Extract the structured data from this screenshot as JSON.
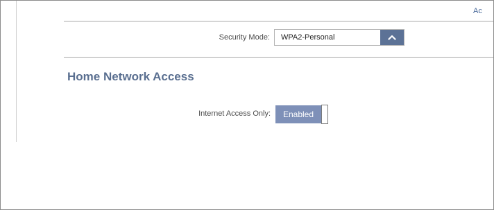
{
  "top_link": "Ac",
  "wireless": {
    "security_mode_label": "Security Mode:",
    "security_mode_value": "WPA2-Personal",
    "dropdown_icon": "chevron-up-icon"
  },
  "home_network": {
    "heading": "Home Network Access",
    "internet_access_label": "Internet Access Only:",
    "internet_access_state": "Enabled"
  },
  "colors": {
    "accent": "#5c7296",
    "toggle_on": "#7e90b8",
    "heading": "#5a6f90"
  }
}
